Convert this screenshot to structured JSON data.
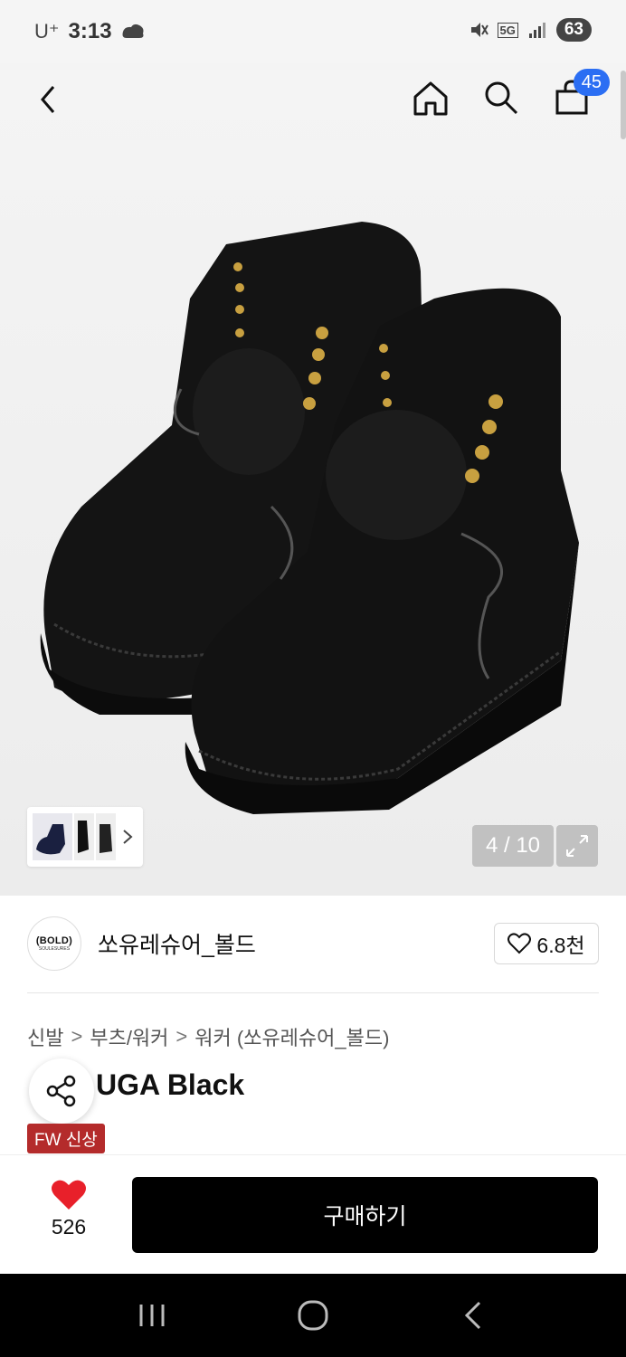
{
  "status_bar": {
    "carrier": "U⁺",
    "time": "3:13",
    "network": "5G",
    "battery": "63"
  },
  "nav": {
    "cart_count": "45"
  },
  "gallery": {
    "counter": "4 / 10"
  },
  "brand": {
    "logo_line1": "(BOLD)",
    "logo_line2": "SOULESURES",
    "name": "쏘유레슈어_볼드",
    "like_count": "6.8천"
  },
  "breadcrumb": {
    "items": [
      "신발",
      "부츠/워커",
      "워커 (쏘유레슈어_볼드)"
    ],
    "separator": ">"
  },
  "product": {
    "title": "UGA Black",
    "tag": "FW 신상"
  },
  "bottom": {
    "favorite_count": "526",
    "buy_label": "구매하기"
  },
  "colors": {
    "accent_blue": "#2b6ef3",
    "tag_red": "#b42b2b",
    "heart_red": "#e8202a",
    "buy_black": "#000000"
  }
}
